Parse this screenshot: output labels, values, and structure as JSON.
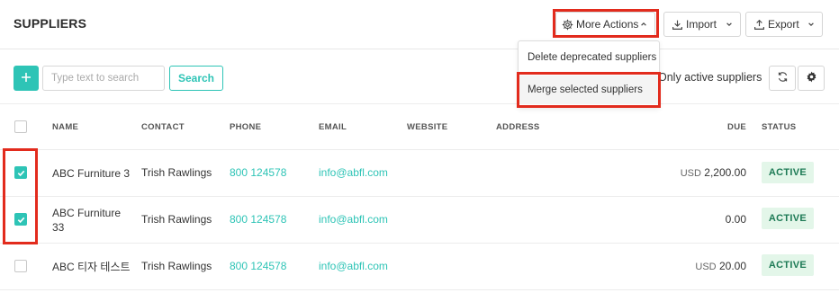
{
  "header": {
    "title": "SUPPLIERS",
    "more_actions_label": "More Actions",
    "import_label": "Import",
    "export_label": "Export"
  },
  "dropdown": {
    "items": [
      {
        "label": "Delete deprecated suppliers"
      },
      {
        "label": "Merge selected suppliers"
      }
    ]
  },
  "toolbar": {
    "search_placeholder": "Type text to search",
    "search_value": "",
    "search_button": "Search",
    "active_filter_label": "Only active suppliers"
  },
  "table": {
    "columns": {
      "name": "NAME",
      "contact": "CONTACT",
      "phone": "PHONE",
      "email": "EMAIL",
      "website": "WEBSITE",
      "address": "ADDRESS",
      "due": "DUE",
      "status": "STATUS"
    },
    "rows": [
      {
        "checked": true,
        "name": "ABC Furniture 3",
        "contact": "Trish Rawlings",
        "phone": "800 124578",
        "email": "info@abfl.com",
        "website": "",
        "address": "",
        "due_currency": "USD",
        "due_amount": "2,200.00",
        "status": "ACTIVE"
      },
      {
        "checked": true,
        "name": "ABC Furniture 33",
        "contact": "Trish Rawlings",
        "phone": "800 124578",
        "email": "info@abfl.com",
        "website": "",
        "address": "",
        "due_currency": "",
        "due_amount": "0.00",
        "status": "ACTIVE"
      },
      {
        "checked": false,
        "name": "ABC 티자 테스트",
        "contact": "Trish Rawlings",
        "phone": "800 124578",
        "email": "info@abfl.com",
        "website": "",
        "address": "",
        "due_currency": "USD",
        "due_amount": "20.00",
        "status": "ACTIVE"
      }
    ]
  },
  "colors": {
    "accent": "#2ec4b6",
    "highlight": "#e22b1d",
    "status_active_bg": "#e3f6e9",
    "status_active_text": "#1d7a55"
  },
  "icons": {
    "more_actions": "gear-icon",
    "import": "download-icon",
    "export": "upload-icon",
    "add": "plus-icon",
    "refresh": "refresh-icon",
    "settings": "gear-icon",
    "checkbox": "check-icon"
  }
}
